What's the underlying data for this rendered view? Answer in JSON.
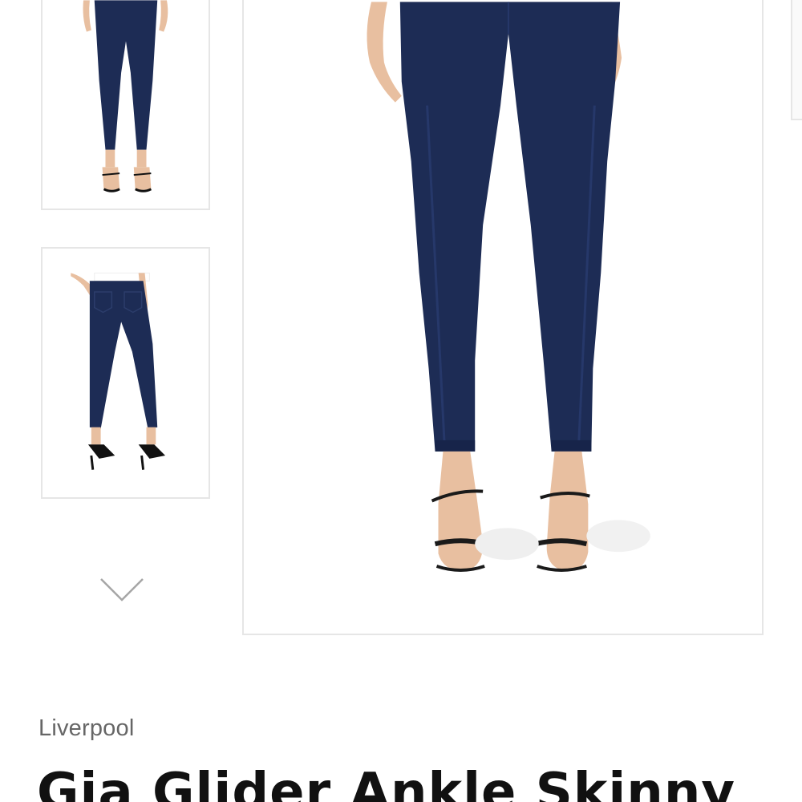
{
  "product": {
    "brand": "Liverpool",
    "title": "Gia Glider Ankle Skinny"
  },
  "gallery": {
    "thumbnails": [
      {
        "view": "front",
        "selected": true
      },
      {
        "view": "back",
        "selected": false
      }
    ],
    "next_icon": "chevron-down-icon",
    "main_view": "front"
  },
  "colors": {
    "denim": "#1d2c55",
    "skin": "#e8bfa0",
    "border": "#e6e6e6",
    "brand_text": "#666666",
    "title_text": "#111111"
  }
}
